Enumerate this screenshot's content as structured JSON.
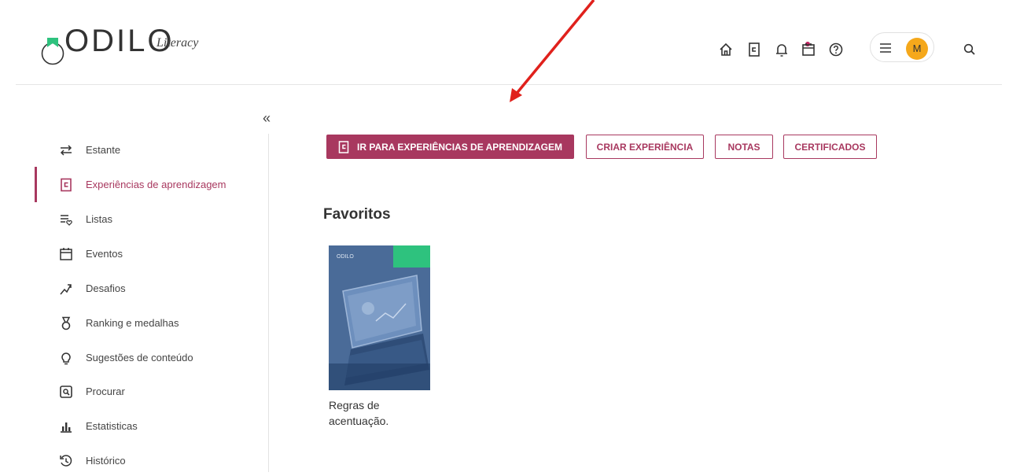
{
  "brand": {
    "name": "ODILO",
    "sub": "Literacy"
  },
  "header": {
    "icons": [
      "home-icon",
      "learning-experience-icon",
      "notification-icon",
      "calendar-icon",
      "help-icon",
      "menu-icon",
      "search-icon"
    ],
    "avatar_initial": "M"
  },
  "sidebar": {
    "collapse_glyph": "«",
    "items": [
      {
        "label": "Estante",
        "icon": "swap-arrows-icon"
      },
      {
        "label": "Experiências de aprendizagem",
        "icon": "learning-experience-icon",
        "active": true
      },
      {
        "label": "Listas",
        "icon": "list-heart-icon"
      },
      {
        "label": "Eventos",
        "icon": "calendar-icon"
      },
      {
        "label": "Desafios",
        "icon": "challenge-icon"
      },
      {
        "label": "Ranking e medalhas",
        "icon": "medal-icon"
      },
      {
        "label": "Sugestões de conteúdo",
        "icon": "lightbulb-icon"
      },
      {
        "label": "Procurar",
        "icon": "search-box-icon"
      },
      {
        "label": "Estatisticas",
        "icon": "bar-chart-icon"
      },
      {
        "label": "Histórico",
        "icon": "history-icon"
      }
    ]
  },
  "actions": {
    "primary": "IR PARA EXPERIÊNCIAS DE APRENDIZAGEM",
    "create": "CRIAR EXPERIÊNCIA",
    "notes": "NOTAS",
    "certificates": "CERTIFICADOS"
  },
  "main": {
    "section_title": "Favoritos",
    "favorites": [
      {
        "title": "Regras de acentuação."
      }
    ]
  },
  "colors": {
    "accent": "#a8385f",
    "avatar": "#f5a81b",
    "arrow": "#e0211c",
    "badge": "#2ec27e"
  }
}
